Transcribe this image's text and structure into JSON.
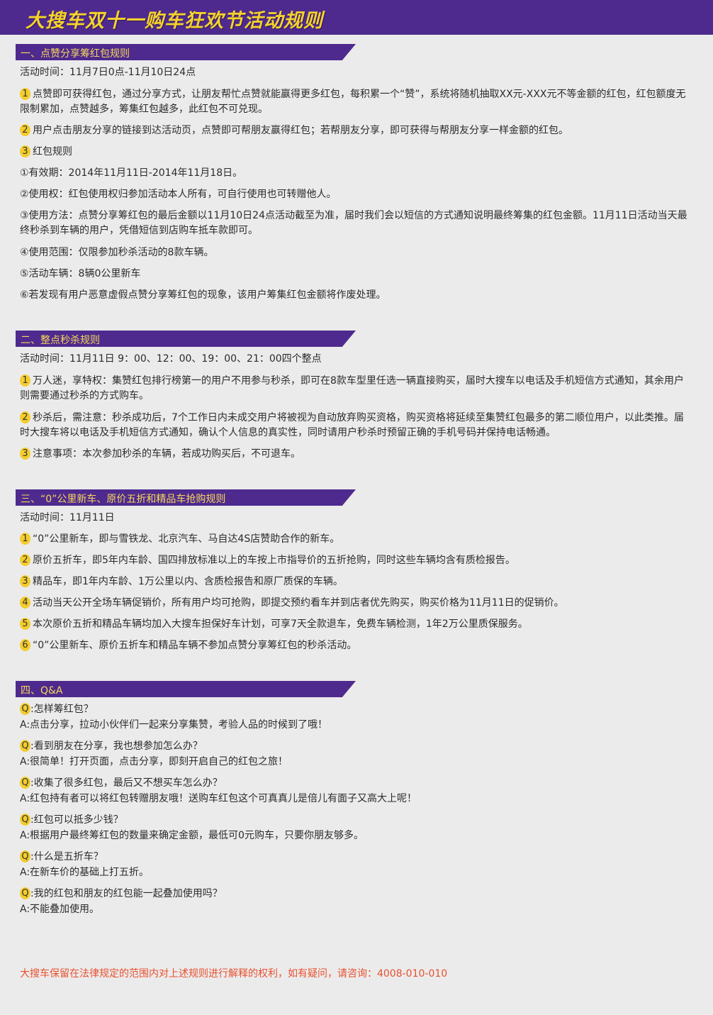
{
  "title": "大搜车双十一购车狂欢节活动规则",
  "s1": {
    "heading": "一、点赞分享筹红包规则",
    "time": "活动时间：11月7日0点-11月10日24点",
    "items": [
      {
        "n": "1",
        "text": "点赞即可获得红包，通过分享方式，让朋友帮忙点赞就能赢得更多红包，每积累一个“赞”，系统将随机抽取XX元-XXX元不等金额的红包，红包额度无限制累加，点赞越多，筹集红包越多，此红包不可兑现。"
      },
      {
        "n": "2",
        "text": "用户点击朋友分享的链接到达活动页，点赞即可帮朋友赢得红包；若帮朋友分享，即可获得与帮朋友分享一样金额的红包。"
      },
      {
        "n": "3",
        "text": "红包规则"
      }
    ],
    "rules": [
      "①有效期：2014年11月11日-2014年11月18日。",
      "②使用权：红包使用权归参加活动本人所有，可自行使用也可转赠他人。",
      "③使用方法：点赞分享筹红包的最后金额以11月10日24点活动截至为准，届时我们会以短信的方式通知说明最终筹集的红包金额。11月11日活动当天最终秒杀到车辆的用户，凭借短信到店购车抵车款即可。",
      "④使用范围：仅限参加秒杀活动的8款车辆。",
      "⑤活动车辆：8辆0公里新车",
      "⑥若发现有用户恶意虚假点赞分享筹红包的现象，该用户筹集红包金额将作废处理。"
    ]
  },
  "s2": {
    "heading": "二、整点秒杀规则",
    "time": "活动时间：11月11日 9：00、12：00、19：00、21：00四个整点",
    "items": [
      {
        "n": "1",
        "text": "万人迷，享特权：集赞红包排行榜第一的用户不用参与秒杀，即可在8款车型里任选一辆直接购买，届时大搜车以电话及手机短信方式通知，其余用户则需要通过秒杀的方式购车。"
      },
      {
        "n": "2",
        "text": "秒杀后，需注意：秒杀成功后，7个工作日内未成交用户将被视为自动放弃购买资格，购买资格将延续至集赞红包最多的第二顺位用户，以此类推。届时大搜车将以电话及手机短信方式通知，确认个人信息的真实性，同时请用户秒杀时预留正确的手机号码并保持电话畅通。"
      },
      {
        "n": "3",
        "text": "注意事项：本次参加秒杀的车辆，若成功购买后，不可退车。"
      }
    ]
  },
  "s3": {
    "heading": "三、“0”公里新车、原价五折和精品车抢购规则",
    "time": "活动时间：11月11日",
    "items": [
      {
        "n": "1",
        "text": "“0”公里新车，即与雪铁龙、北京汽车、马自达4S店赞助合作的新车。"
      },
      {
        "n": "2",
        "text": "原价五折车，即5年内车龄、国四排放标准以上的车按上市指导价的五折抢购，同时这些车辆均含有质检报告。"
      },
      {
        "n": "3",
        "text": "精品车，即1年内车龄、1万公里以内、含质检报告和原厂质保的车辆。"
      },
      {
        "n": "4",
        "text": "活动当天公开全场车辆促销价，所有用户均可抢购，即提交预约看车并到店者优先购买，购买价格为11月11日的促销价。"
      },
      {
        "n": "5",
        "text": "本次原价五折和精品车辆均加入大搜车担保好车计划，可享7天全款退车，免费车辆检测，1年2万公里质保服务。"
      },
      {
        "n": "6",
        "text": "“0”公里新车、原价五折车和精品车辆不参加点赞分享筹红包的秒杀活动。"
      }
    ]
  },
  "s4": {
    "heading": "四、Q&A",
    "q_label": "Q",
    "a_label": "A",
    "pairs": [
      {
        "q": ":怎样筹红包？",
        "a": ":点击分享，拉动小伙伴们一起来分享集赞，考验人品的时候到了哦！"
      },
      {
        "q": ":看到朋友在分享，我也想参加怎么办？",
        "a": ":很简单！打开页面，点击分享，即刻开启自己的红包之旅！"
      },
      {
        "q": ":收集了很多红包，最后又不想买车怎么办？",
        "a": ":红包持有者可以将红包转赠朋友哦！送购车红包这个可真真儿是倍儿有面子又高大上呢！"
      },
      {
        "q": ":红包可以抵多少钱？",
        "a": ":根据用户最终筹红包的数量来确定金额，最低可0元购车，只要你朋友够多。"
      },
      {
        "q": ":什么是五折车？",
        "a": ":在新车价的基础上打五折。"
      },
      {
        "q": ":我的红包和朋友的红包能一起叠加使用吗？",
        "a": ":不能叠加使用。"
      }
    ]
  },
  "footer": "大搜车保留在法律规定的范围内对上述规则进行解释的权利，如有疑问，请咨询：4008-010-010",
  "colors": {
    "brand_purple": "#4e2a8e",
    "accent_yellow": "#f4cc2c",
    "footer_red": "#e8502f"
  }
}
